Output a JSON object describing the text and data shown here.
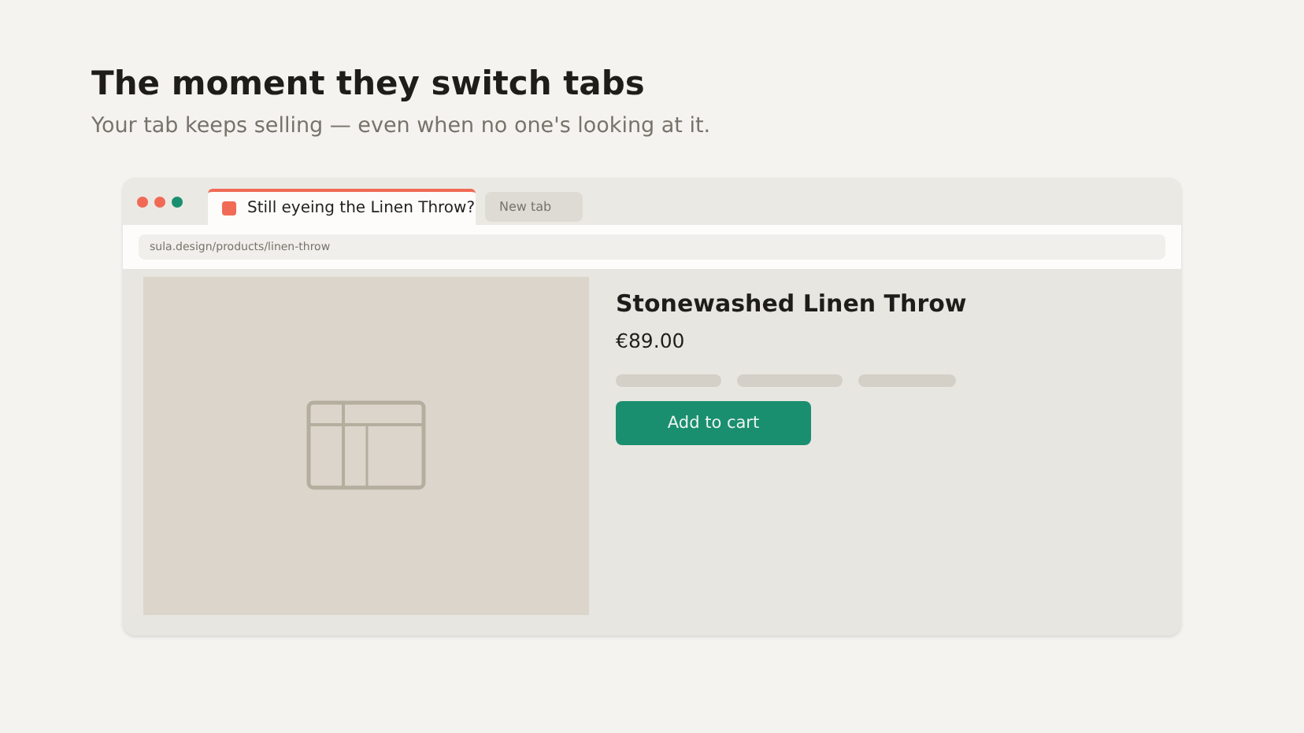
{
  "heading": "The moment they switch tabs",
  "subtitle": "Your tab keeps selling — even when no one's looking at it.",
  "browser": {
    "tabs": [
      {
        "label": "Still eyeing the Linen Throw?",
        "selected": true
      },
      {
        "label": "New tab",
        "selected": false
      }
    ],
    "address": "sula.design/products/linen-throw",
    "product": {
      "kind": "picture",
      "title": "Stonewashed Linen Throw",
      "price": "€89.00",
      "button": "Add to cart"
    }
  }
}
